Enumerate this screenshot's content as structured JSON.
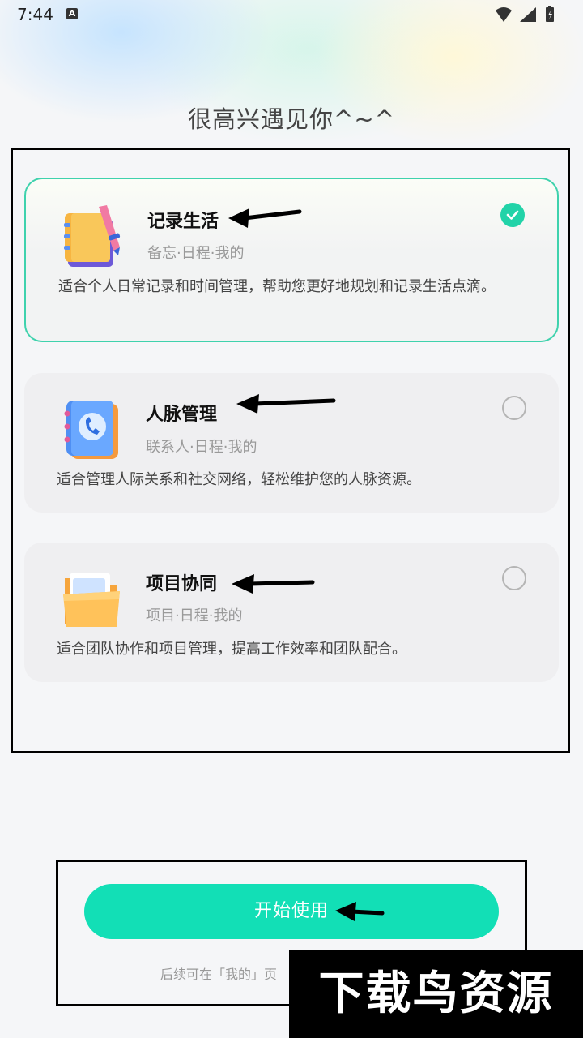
{
  "status": {
    "time": "7:44",
    "notification_glyph": "A"
  },
  "page": {
    "title": "很高兴遇见你^~^"
  },
  "options": [
    {
      "title": "记录生活",
      "subtitle": "备忘·日程·我的",
      "description": "适合个人日常记录和时间管理，帮助您更好地规划和记录生活点滴。",
      "selected": true,
      "icon": "notebook-icon"
    },
    {
      "title": "人脉管理",
      "subtitle": "联系人·日程·我的",
      "description": "适合管理人际关系和社交网络，轻松维护您的人脉资源。",
      "selected": false,
      "icon": "contact-book-icon"
    },
    {
      "title": "项目协同",
      "subtitle": "项目·日程·我的",
      "description": "适合团队协作和项目管理，提高工作效率和团队配合。",
      "selected": false,
      "icon": "folder-icon"
    }
  ],
  "actions": {
    "start_label": "开始使用"
  },
  "footer": {
    "hint": "后续可在「我的」页"
  },
  "watermark": {
    "text": "下载鸟资源"
  },
  "colors": {
    "accent": "#12dfb6",
    "selected_border": "#3fd2ad",
    "check": "#22d3a8"
  }
}
